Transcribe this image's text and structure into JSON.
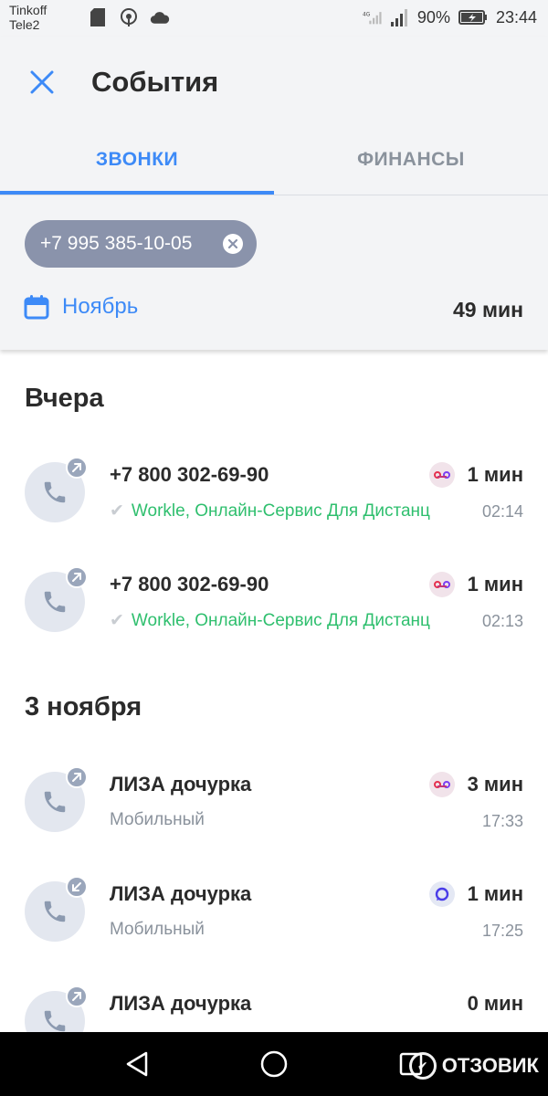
{
  "status_bar": {
    "carrier_1": "Tinkoff",
    "carrier_2": "Tele2",
    "network_label": "4G",
    "battery": "90%",
    "time": "23:44"
  },
  "header": {
    "title": "События",
    "tabs": [
      {
        "label": "ЗВОНКИ",
        "active": true
      },
      {
        "label": "ФИНАНСЫ",
        "active": false
      }
    ],
    "filter_chip": "+7 995 385-10-05",
    "month": "Ноябрь",
    "total": "49 мин"
  },
  "sections": [
    {
      "title": "Вчера",
      "rows": [
        {
          "name": "+7 800 302-69-90",
          "subtitle": "Workle, Онлайн-Сервис Для Дистанц",
          "verified": true,
          "duration": "1 мин",
          "time": "02:14",
          "direction": "outgoing",
          "service_icon": "record-icon"
        },
        {
          "name": "+7 800 302-69-90",
          "subtitle": "Workle, Онлайн-Сервис Для Дистанц",
          "verified": true,
          "duration": "1 мин",
          "time": "02:13",
          "direction": "outgoing",
          "service_icon": "record-icon"
        }
      ]
    },
    {
      "title": "3 ноября",
      "rows": [
        {
          "name": "ЛИЗА дочурка",
          "subtitle": "Мобильный",
          "verified": false,
          "duration": "3 мин",
          "time": "17:33",
          "direction": "outgoing",
          "service_icon": "record-icon"
        },
        {
          "name": "ЛИЗА дочурка",
          "subtitle": "Мобильный",
          "verified": false,
          "duration": "1 мин",
          "time": "17:25",
          "direction": "incoming",
          "service_icon": "chat-icon"
        },
        {
          "name": "ЛИЗА дочурка",
          "subtitle": "",
          "verified": false,
          "duration": "0 мин",
          "time": "",
          "direction": "outgoing",
          "service_icon": ""
        }
      ]
    }
  ],
  "watermark": "ОТЗОВИК",
  "colors": {
    "accent": "#3d8af7",
    "green": "#2fbf6e",
    "chip": "#8a93ab"
  }
}
